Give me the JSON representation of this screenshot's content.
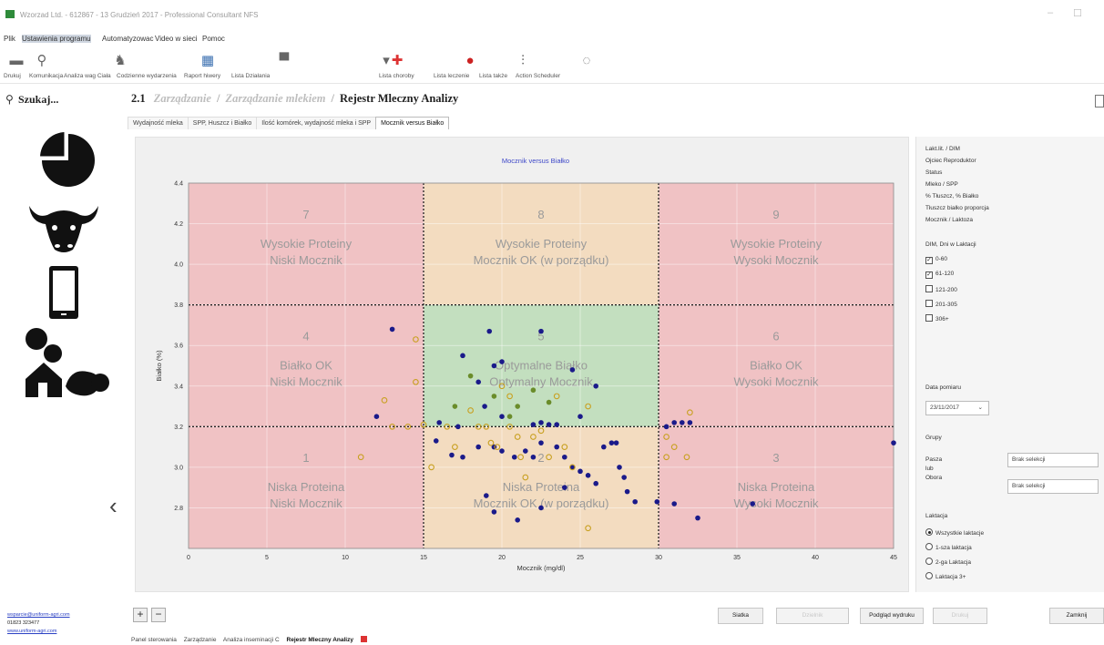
{
  "window": {
    "title": "Wzorzad Ltd. - 612867 - 13 Grudzień 2017 - Professional Consultant NFS"
  },
  "menu": {
    "items": [
      "Plik",
      "Ustawienia programu",
      "Automatyzowac",
      "Video w sieci",
      "Pomoc"
    ]
  },
  "toolbar": {
    "items": [
      "Drukuj",
      "Komunikacja",
      "Analiza wag Ciała",
      "Codzienne wydarzenia",
      "Raport hiwery",
      "Lista Działania",
      "Lista choroby",
      "Lista leczenie",
      "Lista także",
      "Action Scheduler"
    ]
  },
  "search": {
    "label": "Szukaj..."
  },
  "breadcrumb": {
    "number": "2.1",
    "part1": "Zarządzanie",
    "part2": "Zarządzanie mlekiem",
    "current": "Rejestr Mleczny Analizy"
  },
  "tabs": [
    "Wydajność mleka",
    "SPP, Huszcz i Białko",
    "Ilość komórek, wydajność mleka i SPP",
    "Mocznik versus Białko"
  ],
  "sidebar": {
    "contact_email": "wsparcie@uniform-agri.com",
    "contact_phone": "01823 323477",
    "contact_web": "www.uniform-agri.com"
  },
  "chart_data": {
    "type": "scatter",
    "title": "Mocznik versus Białko",
    "xlabel": "Mocznik (mg/dl)",
    "ylabel": "Białko (%)",
    "xlim": [
      0,
      45
    ],
    "ylim": [
      2.6,
      4.4
    ],
    "xticks": [
      0,
      5,
      10,
      15,
      20,
      25,
      30,
      35,
      40,
      45
    ],
    "yticks": [
      2.8,
      3.0,
      3.2,
      3.4,
      3.6,
      3.8,
      4.0,
      4.2,
      4.4
    ],
    "grid": true,
    "zone_dividers": {
      "x": [
        15,
        30
      ],
      "y": [
        3.2,
        3.8
      ]
    },
    "zones": [
      {
        "num": "7",
        "line1": "Wysokie Proteiny",
        "line2": "Niski Mocznik",
        "color": "#f0c2c4"
      },
      {
        "num": "8",
        "line1": "Wysokie Proteiny",
        "line2": "Mocznik OK (w porządku)",
        "color": "#f3dcc0"
      },
      {
        "num": "9",
        "line1": "Wysokie Proteiny",
        "line2": "Wysoki Mocznik",
        "color": "#f0c2c4"
      },
      {
        "num": "4",
        "line1": "Białko OK",
        "line2": "Niski Mocznik",
        "color": "#f0c2c4"
      },
      {
        "num": "5",
        "line1": "Optymalne Białko",
        "line2": "Optymalny Mocznik",
        "color": "#c3dfbf"
      },
      {
        "num": "6",
        "line1": "Białko OK",
        "line2": "Wysoki Mocznik",
        "color": "#f0c2c4"
      },
      {
        "num": "1",
        "line1": "Niska Proteina",
        "line2": "Niski Mocznik",
        "color": "#f0c2c4"
      },
      {
        "num": "2",
        "line1": "Niska Proteina",
        "line2": "Mocznik OK (w porządku)",
        "color": "#f3dcc0"
      },
      {
        "num": "3",
        "line1": "Niska Proteina",
        "line2": "Wysoki Mocznik",
        "color": "#f0c2c4"
      }
    ],
    "series": [
      {
        "name": "0-60",
        "marker": "filled-circle",
        "color": "#1a1a8a",
        "points": [
          [
            13,
            3.68
          ],
          [
            12,
            3.25
          ],
          [
            17.5,
            3.55
          ],
          [
            19.2,
            3.67
          ],
          [
            19.5,
            3.5
          ],
          [
            20,
            3.52
          ],
          [
            18.5,
            3.42
          ],
          [
            22.5,
            3.67
          ],
          [
            24.5,
            3.48
          ],
          [
            26,
            3.4
          ],
          [
            25,
            3.25
          ],
          [
            22.5,
            3.22
          ],
          [
            20,
            3.25
          ],
          [
            18.9,
            3.3
          ],
          [
            17.2,
            3.2
          ],
          [
            16,
            3.22
          ],
          [
            15.8,
            3.13
          ],
          [
            16.8,
            3.06
          ],
          [
            17.5,
            3.05
          ],
          [
            18.5,
            3.1
          ],
          [
            19.5,
            3.1
          ],
          [
            20,
            3.08
          ],
          [
            20.8,
            3.05
          ],
          [
            21.5,
            3.08
          ],
          [
            22,
            3.05
          ],
          [
            22.5,
            3.12
          ],
          [
            23.5,
            3.1
          ],
          [
            24,
            3.05
          ],
          [
            24.5,
            3.0
          ],
          [
            25,
            2.98
          ],
          [
            25.5,
            2.96
          ],
          [
            26,
            2.92
          ],
          [
            26.5,
            3.1
          ],
          [
            27,
            3.12
          ],
          [
            27.3,
            3.12
          ],
          [
            27.5,
            3.0
          ],
          [
            27.8,
            2.95
          ],
          [
            28,
            2.88
          ],
          [
            28.5,
            2.83
          ],
          [
            29.9,
            2.83
          ],
          [
            31,
            2.82
          ],
          [
            32.5,
            2.75
          ],
          [
            21,
            2.74
          ],
          [
            19,
            2.86
          ],
          [
            19.5,
            2.78
          ],
          [
            22.5,
            2.8
          ],
          [
            24,
            2.9
          ],
          [
            31,
            3.22
          ],
          [
            31.5,
            3.22
          ],
          [
            30.5,
            3.2
          ],
          [
            32,
            3.22
          ],
          [
            36,
            2.82
          ],
          [
            45,
            3.12
          ],
          [
            22,
            3.21
          ],
          [
            23,
            3.21
          ],
          [
            23.5,
            3.21
          ]
        ]
      },
      {
        "name": "61-120",
        "marker": "open-circle",
        "color": "#c8a020",
        "points": [
          [
            14.5,
            3.63
          ],
          [
            14.5,
            3.42
          ],
          [
            12.5,
            3.33
          ],
          [
            13,
            3.2
          ],
          [
            11,
            3.05
          ],
          [
            14,
            3.2
          ],
          [
            15,
            3.21
          ],
          [
            16.5,
            3.2
          ],
          [
            17,
            3.1
          ],
          [
            18.5,
            3.2
          ],
          [
            19,
            3.2
          ],
          [
            19.3,
            3.12
          ],
          [
            19.7,
            3.1
          ],
          [
            20.5,
            3.2
          ],
          [
            21,
            3.15
          ],
          [
            21.2,
            3.05
          ],
          [
            21.5,
            2.95
          ],
          [
            22,
            3.15
          ],
          [
            22.5,
            3.18
          ],
          [
            23,
            3.05
          ],
          [
            24,
            3.1
          ],
          [
            24.5,
            3.0
          ],
          [
            23.5,
            3.35
          ],
          [
            25.5,
            3.3
          ],
          [
            20.5,
            3.35
          ],
          [
            18,
            3.28
          ],
          [
            15.5,
            3.0
          ],
          [
            25.5,
            2.7
          ],
          [
            30.5,
            3.15
          ],
          [
            31,
            3.1
          ],
          [
            32,
            3.27
          ],
          [
            30.5,
            3.05
          ],
          [
            31.8,
            3.05
          ],
          [
            20,
            3.4
          ]
        ]
      },
      {
        "name": "0-60 green",
        "marker": "filled-circle",
        "color": "#6a8c2a",
        "points": [
          [
            18,
            3.45
          ],
          [
            19.5,
            3.35
          ],
          [
            21,
            3.3
          ],
          [
            22,
            3.38
          ],
          [
            23,
            3.32
          ],
          [
            17,
            3.3
          ],
          [
            20.5,
            3.25
          ]
        ]
      }
    ]
  },
  "right_panel": {
    "menu_items": [
      "Lakt.lit. / DIM",
      "Ojciec Reproduktor",
      "Status",
      "Mleko / SPP",
      "% Tłuszcz, % Białko",
      "Tłuszcz białko proporcja",
      "Mocznik / Laktoza"
    ],
    "dim_label": "DIM, Dni w Laktacji",
    "dim_options": [
      {
        "label": "0-60",
        "checked": true
      },
      {
        "label": "61-120",
        "checked": true
      },
      {
        "label": "121-200",
        "checked": false
      },
      {
        "label": "201-305",
        "checked": false
      },
      {
        "label": "306+",
        "checked": false
      }
    ],
    "date_label": "Data pomiaru",
    "date_value": "23/11/2017",
    "groups_label": "Grupy",
    "group_pasza_label": "Pasza",
    "group_lub_label": "lub",
    "group_obora_label": "Obora",
    "group_pasza_value": "Brak selekcji",
    "group_obora_value": "Brak selekcji",
    "lactation_label": "Laktacja",
    "lactation_options": [
      {
        "label": "Wszystkie laktacje",
        "selected": true
      },
      {
        "label": "1-sza laktacja",
        "selected": false
      },
      {
        "label": "2-ga Laktacja",
        "selected": false
      },
      {
        "label": "Laktacja 3+",
        "selected": false
      }
    ]
  },
  "bottom": {
    "plus": "+",
    "minus": "−",
    "buttons": [
      {
        "label": "Siatka",
        "disabled": false
      },
      {
        "label": "Dzielnik",
        "disabled": true
      },
      {
        "label": "Podgląd wydruku",
        "disabled": false
      },
      {
        "label": "Drukuj",
        "disabled": true
      },
      {
        "label": "Zamknij",
        "disabled": false
      }
    ],
    "tabs": [
      "Panel sterowania",
      "Zarządzanie",
      "Analiza inseminacji C",
      "Rejestr Mleczny Analizy"
    ]
  }
}
